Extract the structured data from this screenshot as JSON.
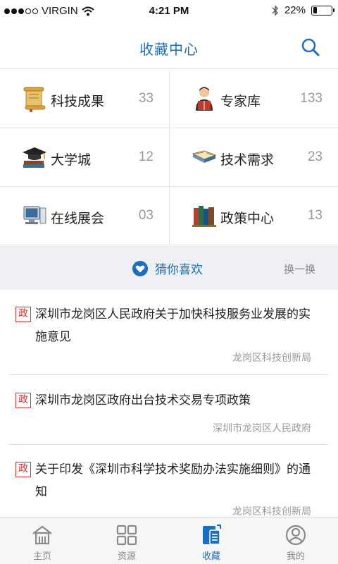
{
  "status_bar": {
    "carrier": "VIRGIN",
    "time": "4:21 PM",
    "battery": "22%",
    "battery_level": 0.22
  },
  "nav": {
    "title": "收藏中心",
    "search_icon": "search-icon"
  },
  "grid": [
    {
      "label": "科技成果",
      "count": "33",
      "icon": "scroll-icon"
    },
    {
      "label": "专家库",
      "count": "133",
      "icon": "expert-icon"
    },
    {
      "label": "大学城",
      "count": "12",
      "icon": "graduation-cap-icon"
    },
    {
      "label": "技术需求",
      "count": "23",
      "icon": "open-book-icon"
    },
    {
      "label": "在线展会",
      "count": "03",
      "icon": "computer-icon"
    },
    {
      "label": "政策中心",
      "count": "13",
      "icon": "books-icon"
    }
  ],
  "recommend": {
    "title": "猜你喜欢",
    "refresh": "换一换"
  },
  "news": [
    {
      "tag": "政",
      "title": "深圳市龙岗区人民政府关于加快科技服务业发展的实施意见",
      "source": "龙岗区科技创新局"
    },
    {
      "tag": "政",
      "title": "深圳市龙岗区政府出台技术交易专项政策",
      "source": "深圳市龙岗区人民政府"
    },
    {
      "tag": "政",
      "title": "关于印发《深圳市科学技术奖励办法实施细则》的通知",
      "source": "龙岗区科技创新局"
    }
  ],
  "tabs": [
    {
      "label": "主页",
      "icon": "home-icon",
      "active": false
    },
    {
      "label": "资源",
      "icon": "grid-icon",
      "active": false
    },
    {
      "label": "收藏",
      "icon": "favorites-icon",
      "active": true
    },
    {
      "label": "我的",
      "icon": "profile-icon",
      "active": false
    }
  ],
  "colors": {
    "accent": "#1b6ec2",
    "tag_red": "#d9342b",
    "section_bg": "#eef0f3"
  }
}
